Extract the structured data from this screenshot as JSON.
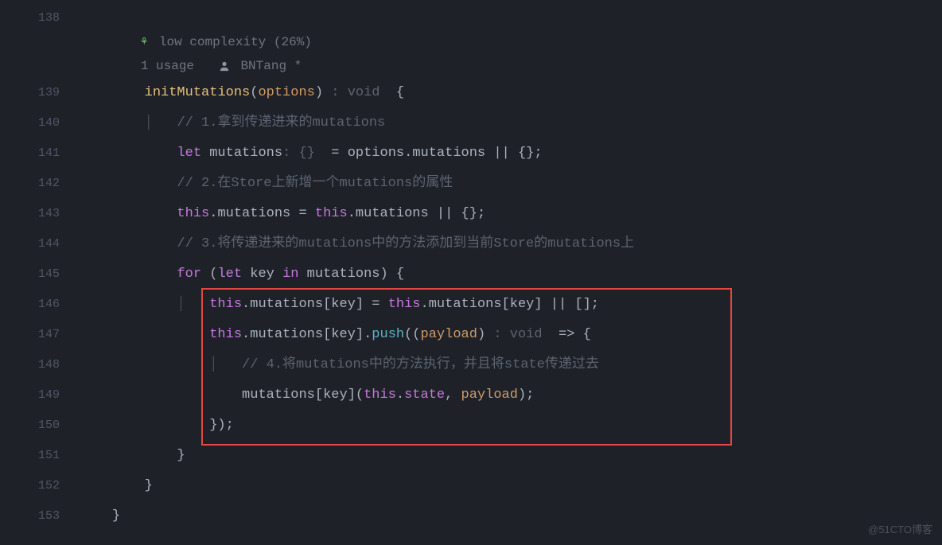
{
  "gutter": {
    "lines": [
      138,
      139,
      140,
      141,
      142,
      143,
      144,
      145,
      146,
      147,
      148,
      149,
      150,
      151,
      152,
      153
    ],
    "changedLines": [
      143,
      146,
      147,
      150
    ]
  },
  "hints": {
    "complexity": "low complexity (26%)",
    "usage": "1 usage",
    "author": "BNTang *"
  },
  "code": {
    "fn_name": "initMutations",
    "fn_param": "options",
    "fn_return": "void",
    "comment1": "// 1.拿到传递进来的mutations",
    "let_kw": "let",
    "mutations_var": "mutations",
    "type_ann": ": {} ",
    "assign1_rhs_options": "options",
    "assign1_rhs_prop": "mutations",
    "fallback_obj": "{}",
    "comment2": "// 2.在Store上新增一个mutations的属性",
    "this_kw": "this",
    "mutations_prop": "mutations",
    "comment3": "// 3.将传递进来的mutations中的方法添加到当前Store的mutations上",
    "for_kw": "for",
    "in_kw": "in",
    "key_var": "key",
    "fallback_arr": "[]",
    "push_method": "push",
    "payload_param": "payload",
    "arrow_return": "void",
    "comment4": "// 4.将mutations中的方法执行，并且将state传递过去",
    "state_prop": "state"
  },
  "watermark": "@51CTO博客"
}
